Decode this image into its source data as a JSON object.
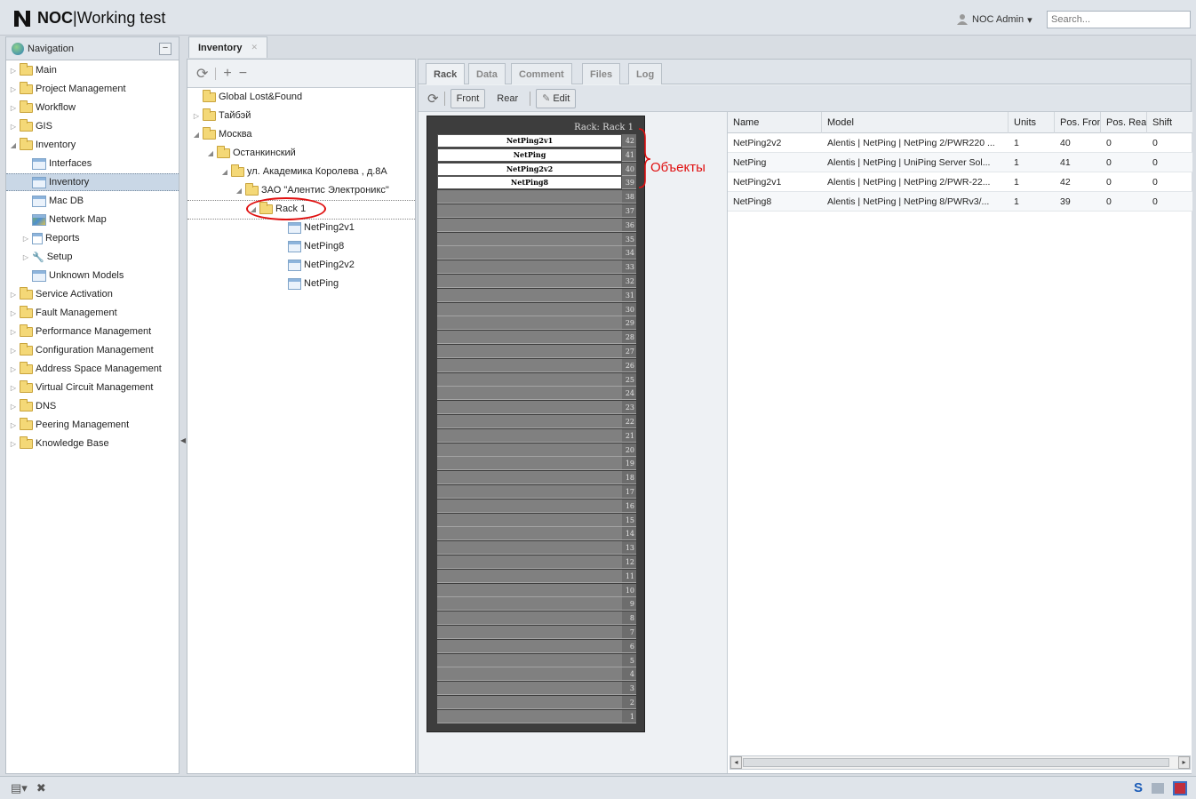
{
  "app": {
    "title_bold": "NOC",
    "title_rest": "Working test"
  },
  "user": {
    "label": "NOC Admin"
  },
  "search": {
    "placeholder": "Search..."
  },
  "nav": {
    "header": "Navigation",
    "items": [
      {
        "label": "Main"
      },
      {
        "label": "Project Management"
      },
      {
        "label": "Workflow"
      },
      {
        "label": "GIS"
      },
      {
        "label": "Inventory"
      },
      {
        "label": "Interfaces"
      },
      {
        "label": "Inventory"
      },
      {
        "label": "Mac DB"
      },
      {
        "label": "Network Map"
      },
      {
        "label": "Reports"
      },
      {
        "label": "Setup"
      },
      {
        "label": "Unknown Models"
      },
      {
        "label": "Service Activation"
      },
      {
        "label": "Fault Management"
      },
      {
        "label": "Performance Management"
      },
      {
        "label": "Configuration Management"
      },
      {
        "label": "Address Space Management"
      },
      {
        "label": "Virtual Circuit Management"
      },
      {
        "label": "DNS"
      },
      {
        "label": "Peering Management"
      },
      {
        "label": "Knowledge Base"
      }
    ]
  },
  "inventory_tab": {
    "label": "Inventory"
  },
  "tree": {
    "items": [
      {
        "label": "Global Lost&Found"
      },
      {
        "label": "Тайбэй"
      },
      {
        "label": "Москва"
      },
      {
        "label": "Останкинский"
      },
      {
        "label": "ул. Академика Королева , д.8А"
      },
      {
        "label": "ЗАО \"Алентис Электроникс\""
      },
      {
        "label": "Rack 1"
      },
      {
        "label": "NetPing2v1"
      },
      {
        "label": "NetPing8"
      },
      {
        "label": "NetPing2v2"
      },
      {
        "label": "NetPing"
      }
    ]
  },
  "detail_tabs": [
    "Rack",
    "Data",
    "Comment",
    "Files",
    "Log"
  ],
  "rack_toolbar": {
    "front": "Front",
    "rear": "Rear",
    "edit": "Edit"
  },
  "rack": {
    "title": "Rack: Rack 1",
    "units": 42,
    "devices": [
      {
        "name": "NetPing2v1",
        "unit": 42
      },
      {
        "name": "NetPing",
        "unit": 41
      },
      {
        "name": "NetPing2v2",
        "unit": 40
      },
      {
        "name": "NetPing8",
        "unit": 39
      }
    ]
  },
  "annotation": {
    "text": "Объекты"
  },
  "grid": {
    "columns": [
      "Name",
      "Model",
      "Units",
      "Pos. Front",
      "Pos. Rear",
      "Shift"
    ],
    "rows": [
      [
        "NetPing2v2",
        "Alentis | NetPing | NetPing 2/PWR220 ...",
        "1",
        "40",
        "0",
        "0"
      ],
      [
        "NetPing",
        "Alentis | NetPing | UniPing Server Sol...",
        "1",
        "41",
        "0",
        "0"
      ],
      [
        "NetPing2v1",
        "Alentis | NetPing | NetPing 2/PWR-22...",
        "1",
        "42",
        "0",
        "0"
      ],
      [
        "NetPing8",
        "Alentis | NetPing | NetPing 8/PWRv3/...",
        "1",
        "39",
        "0",
        "0"
      ]
    ]
  },
  "colors": {
    "annotation": "#e01010",
    "panel_bg": "#eef1f4",
    "rack_bg": "#3d3d3d"
  }
}
